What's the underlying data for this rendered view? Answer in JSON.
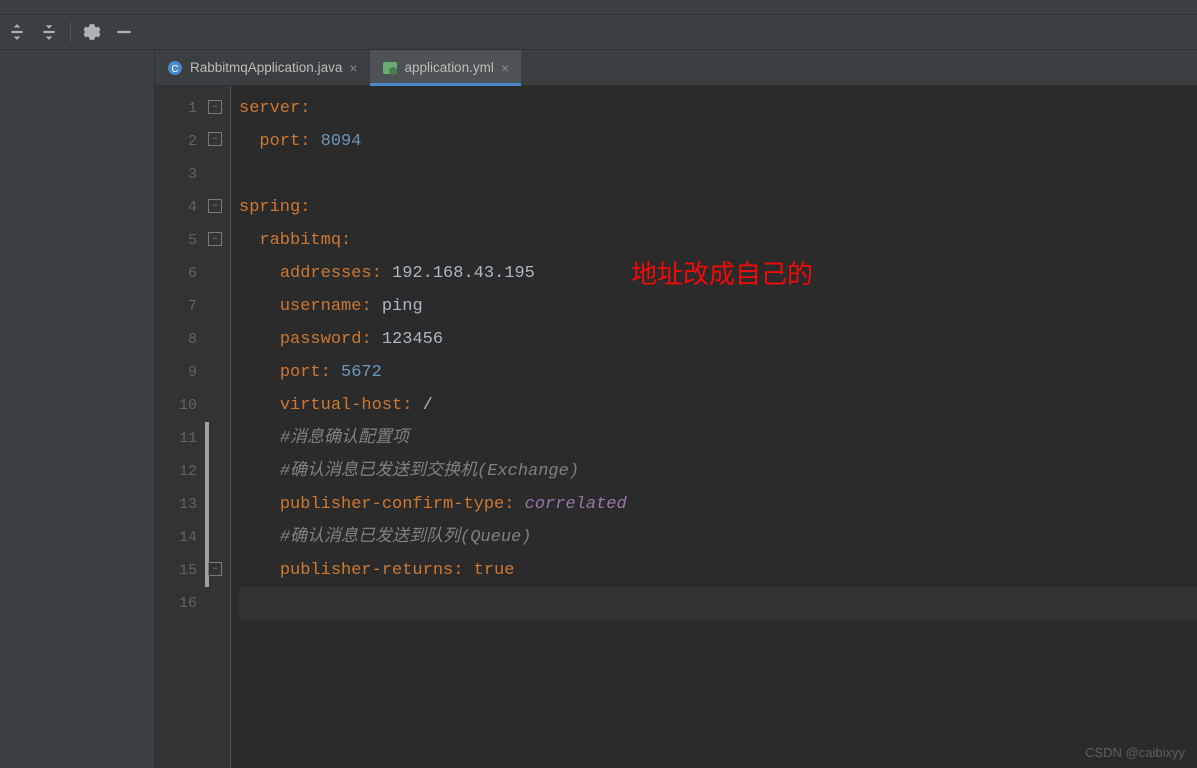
{
  "tabs": [
    {
      "label": "RabbitmqApplication.java",
      "active": false
    },
    {
      "label": "application.yml",
      "active": true
    }
  ],
  "lines": [
    "1",
    "2",
    "3",
    "4",
    "5",
    "6",
    "7",
    "8",
    "9",
    "10",
    "11",
    "12",
    "13",
    "14",
    "15",
    "16"
  ],
  "code": {
    "l1_key": "server",
    "l2_key": "port",
    "l2_val": "8094",
    "l4_key": "spring",
    "l5_key": "rabbitmq",
    "l6_key": "addresses",
    "l6_val": "192.168.43.195",
    "l7_key": "username",
    "l7_val": "ping",
    "l8_key": "password",
    "l8_val": "123456",
    "l9_key": "port",
    "l9_val": "5672",
    "l10_key": "virtual-host",
    "l10_val": "/",
    "l11_comment": "#消息确认配置项",
    "l12_comment": "#确认消息已发送到交换机(Exchange)",
    "l13_key": "publisher-confirm-type",
    "l13_val": "correlated",
    "l14_comment": "#确认消息已发送到队列(Queue)",
    "l15_key": "publisher-returns",
    "l15_val": "true"
  },
  "annotation": "地址改成自己的",
  "watermark": "CSDN @caibixyy"
}
